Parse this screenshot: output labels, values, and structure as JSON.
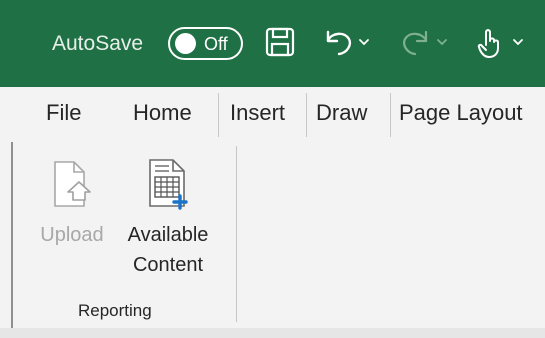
{
  "titlebar": {
    "autosave_label": "AutoSave",
    "toggle_state": "Off",
    "accent_color": "#1f7145",
    "icons": [
      "save-icon",
      "undo-icon",
      "redo-icon",
      "touch-mode-icon"
    ]
  },
  "tabs": [
    "File",
    "Home",
    "Insert",
    "Draw",
    "Page Layout"
  ],
  "ribbon": {
    "group_label": "Reporting",
    "buttons": [
      {
        "label": "Upload",
        "icon": "upload-icon",
        "enabled": false
      },
      {
        "label_line1": "Available",
        "label_line2": "Content",
        "icon": "available-content-icon",
        "enabled": true
      }
    ]
  }
}
